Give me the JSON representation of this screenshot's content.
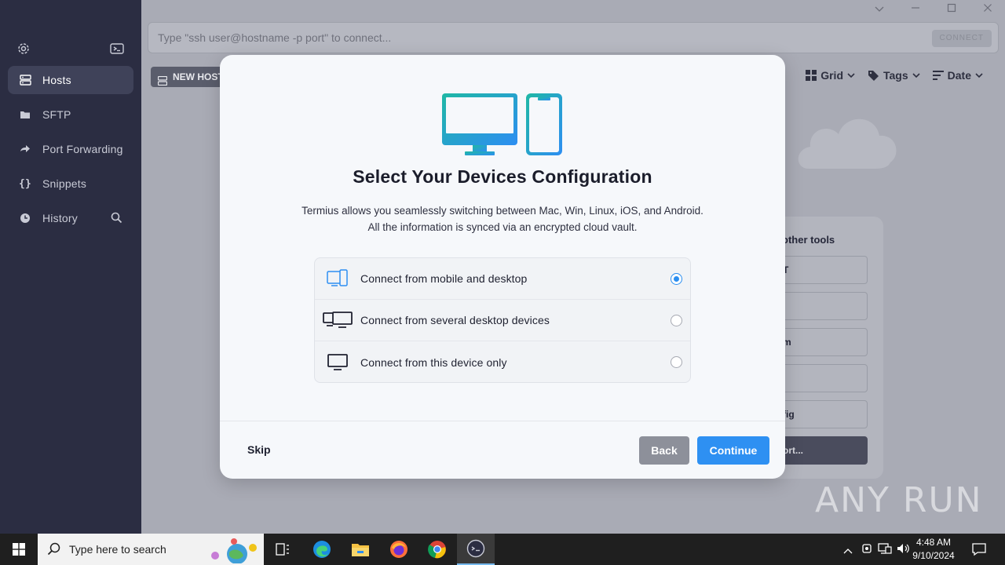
{
  "sidebar": {
    "items": [
      {
        "label": "Hosts",
        "icon": "hosts-icon",
        "active": true
      },
      {
        "label": "SFTP",
        "icon": "folder-icon"
      },
      {
        "label": "Port Forwarding",
        "icon": "port-forward-icon"
      },
      {
        "label": "Snippets",
        "icon": "braces-icon"
      },
      {
        "label": "History",
        "icon": "clock-icon"
      }
    ]
  },
  "topbar": {
    "placeholder": "Type \"ssh user@hostname -p port\" to connect...",
    "connect_label": "CONNECT"
  },
  "toolbar": {
    "new_host_label": "NEW HOST",
    "grid_label": "Grid",
    "tags_label": "Tags",
    "date_label": "Date"
  },
  "panel": {
    "title": "other tools",
    "rows": [
      "T",
      "",
      "m",
      "",
      "fig",
      "ort..."
    ]
  },
  "modal": {
    "title": "Select Your Devices Configuration",
    "description_line1": "Termius allows you seamlessly switching between Mac, Win, Linux, iOS, and Android.",
    "description_line2": "All the information is synced via an encrypted cloud vault.",
    "options": [
      {
        "label": "Connect from mobile and desktop",
        "selected": true
      },
      {
        "label": "Connect from several desktop devices",
        "selected": false
      },
      {
        "label": "Connect from this device only",
        "selected": false
      }
    ],
    "skip_label": "Skip",
    "back_label": "Back",
    "continue_label": "Continue"
  },
  "watermark": "ANY RUN",
  "taskbar": {
    "search_placeholder": "Type here to search",
    "time": "4:48 AM",
    "date": "9/10/2024"
  },
  "colors": {
    "sidebar_bg": "#2b2d42",
    "accent_blue": "#2e90f2",
    "hero_gradient_start": "#1fb8a5",
    "hero_gradient_end": "#2d8ef2"
  }
}
